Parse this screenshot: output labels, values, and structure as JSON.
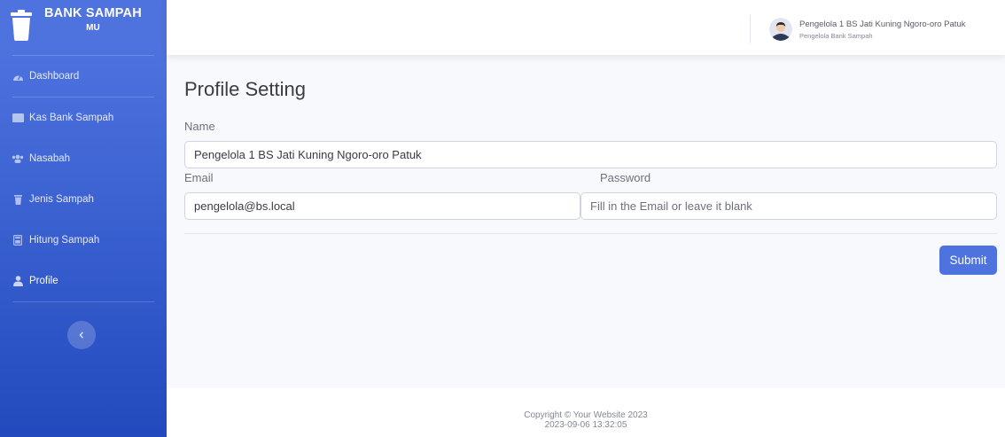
{
  "brand": {
    "title": "BANK SAMPAH",
    "subtitle": "MU",
    "icon": "trash-icon"
  },
  "sidebar": {
    "items": [
      {
        "label": "Dashboard",
        "icon": "tachometer-icon"
      },
      {
        "label": "Kas Bank Sampah",
        "icon": "cash-icon"
      },
      {
        "label": "Nasabah",
        "icon": "users-icon"
      },
      {
        "label": "Jenis Sampah",
        "icon": "trash-icon"
      },
      {
        "label": "Hitung Sampah",
        "icon": "calculator-icon"
      },
      {
        "label": "Profile",
        "icon": "user-icon"
      }
    ],
    "toggle_icon": "chevron-left-icon"
  },
  "topbar": {
    "user_name": "Pengelola 1 BS Jati Kuning Ngoro-oro Patuk",
    "user_role": "Pengelola Bank Sampah"
  },
  "page": {
    "title": "Profile Setting",
    "name_label": "Name",
    "name_value": "Pengelola 1 BS Jati Kuning Ngoro-oro Patuk",
    "email_label": "Email",
    "email_value": "pengelola@bs.local",
    "password_label": "Password",
    "password_placeholder": "Fill in the Email or leave it blank",
    "submit_label": "Submit"
  },
  "footer": {
    "copyright": "Copyright © Your Website 2023",
    "timestamp": "2023-09-06 13:32:05"
  },
  "colors": {
    "primary": "#4e73df",
    "primary_dark": "#224abe",
    "background": "#f8f9fc"
  }
}
